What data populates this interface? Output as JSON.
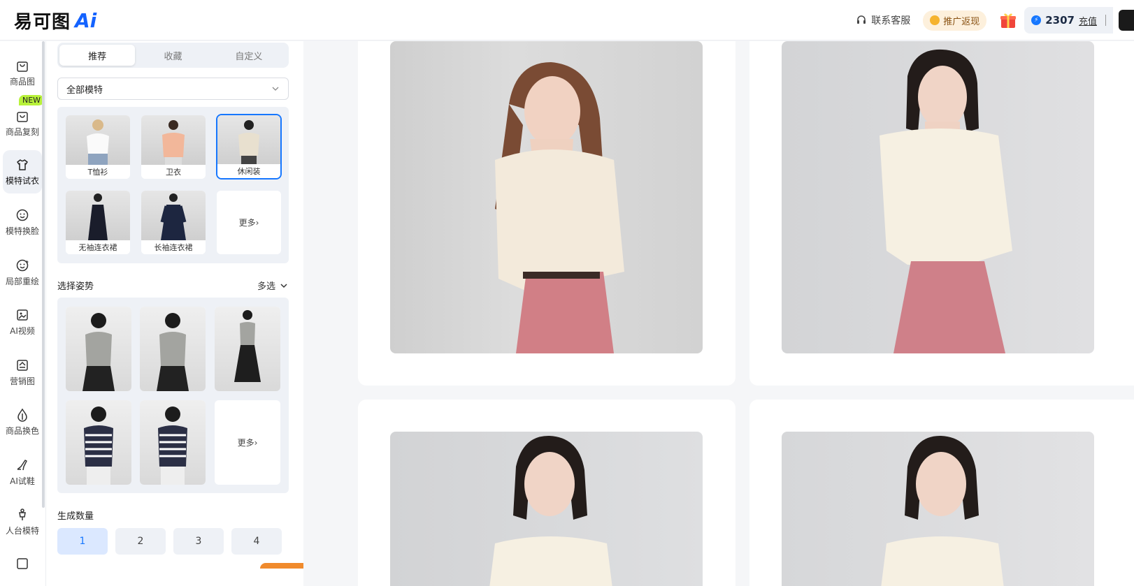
{
  "header": {
    "logo_text": "易可图",
    "logo_ai": "Ai",
    "support_label": "联系客服",
    "promo_label": "推广返现",
    "balance": "2307",
    "recharge_label": "充值"
  },
  "nav": {
    "items": [
      {
        "label": "商品图",
        "icon": "bag-icon"
      },
      {
        "label": "商品复刻",
        "icon": "bag-copy-icon",
        "badge": "NEW"
      },
      {
        "label": "模特试衣",
        "icon": "shirt-icon",
        "active": true
      },
      {
        "label": "模特换脸",
        "icon": "face-icon"
      },
      {
        "label": "局部重绘",
        "icon": "face-sparkle-icon"
      },
      {
        "label": "AI视频",
        "icon": "video-icon"
      },
      {
        "label": "营销图",
        "icon": "marketing-icon"
      },
      {
        "label": "商品换色",
        "icon": "drop-icon"
      },
      {
        "label": "AI试鞋",
        "icon": "shoe-icon"
      },
      {
        "label": "人台模特",
        "icon": "mannequin-icon"
      }
    ]
  },
  "panel": {
    "tabs": [
      "推荐",
      "收藏",
      "自定义"
    ],
    "active_tab": "推荐",
    "model_filter": "全部模特",
    "categories": [
      "T恤衫",
      "卫衣",
      "休闲装",
      "无袖连衣裙",
      "长袖连衣裙"
    ],
    "selected_category": "休闲装",
    "more_label": "更多",
    "pose_title": "选择姿势",
    "multi_select_label": "多选",
    "count_title": "生成数量",
    "counts": [
      "1",
      "2",
      "3",
      "4"
    ],
    "selected_count": "1"
  },
  "colors": {
    "accent": "#1677ff",
    "new_badge": "#b8f23a",
    "panel_bg": "#eef1f6",
    "page_bg": "#f5f6f8"
  }
}
